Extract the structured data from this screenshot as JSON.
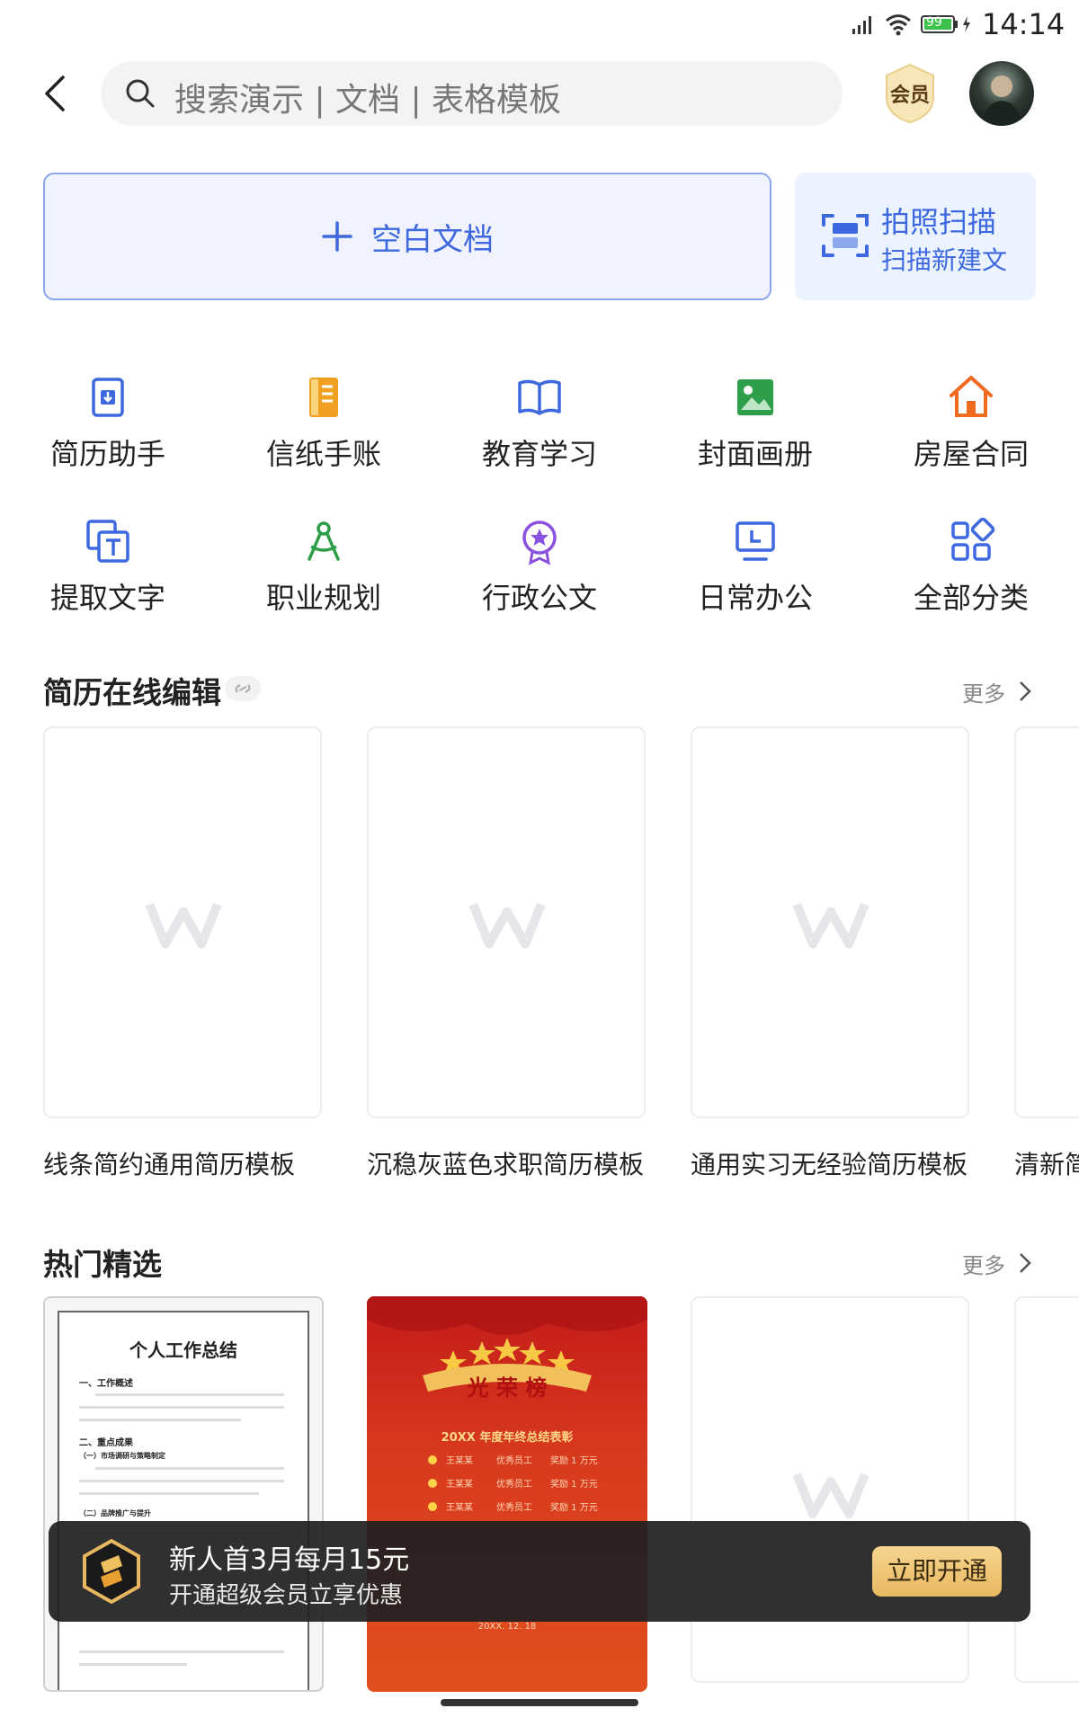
{
  "status_bar": {
    "time": "14:14",
    "battery": "99"
  },
  "header": {
    "search_placeholder": "搜索演示 | 文档 | 表格模板",
    "vip_label": "会员"
  },
  "actions": {
    "blank_doc": "空白文档",
    "scan_title": "拍照扫描",
    "scan_subtitle": "扫描新建文"
  },
  "categories": [
    {
      "label": "简历助手",
      "icon": "resume-icon",
      "color": "#3d68e0"
    },
    {
      "label": "信纸手账",
      "icon": "notebook-icon",
      "color": "#f0a020"
    },
    {
      "label": "教育学习",
      "icon": "book-icon",
      "color": "#3d68e0"
    },
    {
      "label": "封面画册",
      "icon": "image-icon",
      "color": "#2e9e4a"
    },
    {
      "label": "房屋合同",
      "icon": "house-icon",
      "color": "#f06a20"
    },
    {
      "label": "提取文字",
      "icon": "extract-text-icon",
      "color": "#3d68e0"
    },
    {
      "label": "职业规划",
      "icon": "compass-icon",
      "color": "#2e9e4a"
    },
    {
      "label": "行政公文",
      "icon": "badge-star-icon",
      "color": "#8a50e0"
    },
    {
      "label": "日常办公",
      "icon": "monitor-icon",
      "color": "#3d68e0"
    },
    {
      "label": "全部分类",
      "icon": "grid-icon",
      "color": "#3d68e0"
    }
  ],
  "resume_section": {
    "title": "简历在线编辑",
    "more": "更多",
    "items": [
      {
        "title": "线条简约通用简历模板"
      },
      {
        "title": "沉稳灰蓝色求职简历模板"
      },
      {
        "title": "通用实习无经验简历模板"
      },
      {
        "title": "清新简"
      }
    ]
  },
  "hot_section": {
    "title": "热门精选",
    "more": "更多",
    "paper": {
      "title": "个人工作总结",
      "h1": "一、工作概述",
      "h2": "二、重点成果",
      "h3": "（一）市场调研与策略制定",
      "h4": "（二）品牌推广与提升"
    },
    "honor": {
      "title": "光 荣 榜",
      "subtitle": "20XX 年度年终总结表彰",
      "rows": [
        [
          "王某某",
          "优秀员工",
          "奖励 1 万元"
        ],
        [
          "王某某",
          "优秀员工",
          "奖励 1 万元"
        ],
        [
          "王某某",
          "优秀员工",
          "奖励 1 万元"
        ]
      ],
      "date": "20XX. 12. 18"
    }
  },
  "promo": {
    "line1": "新人首3月每月15元",
    "line2": "开通超级会员立享优惠",
    "cta": "立即开通"
  }
}
